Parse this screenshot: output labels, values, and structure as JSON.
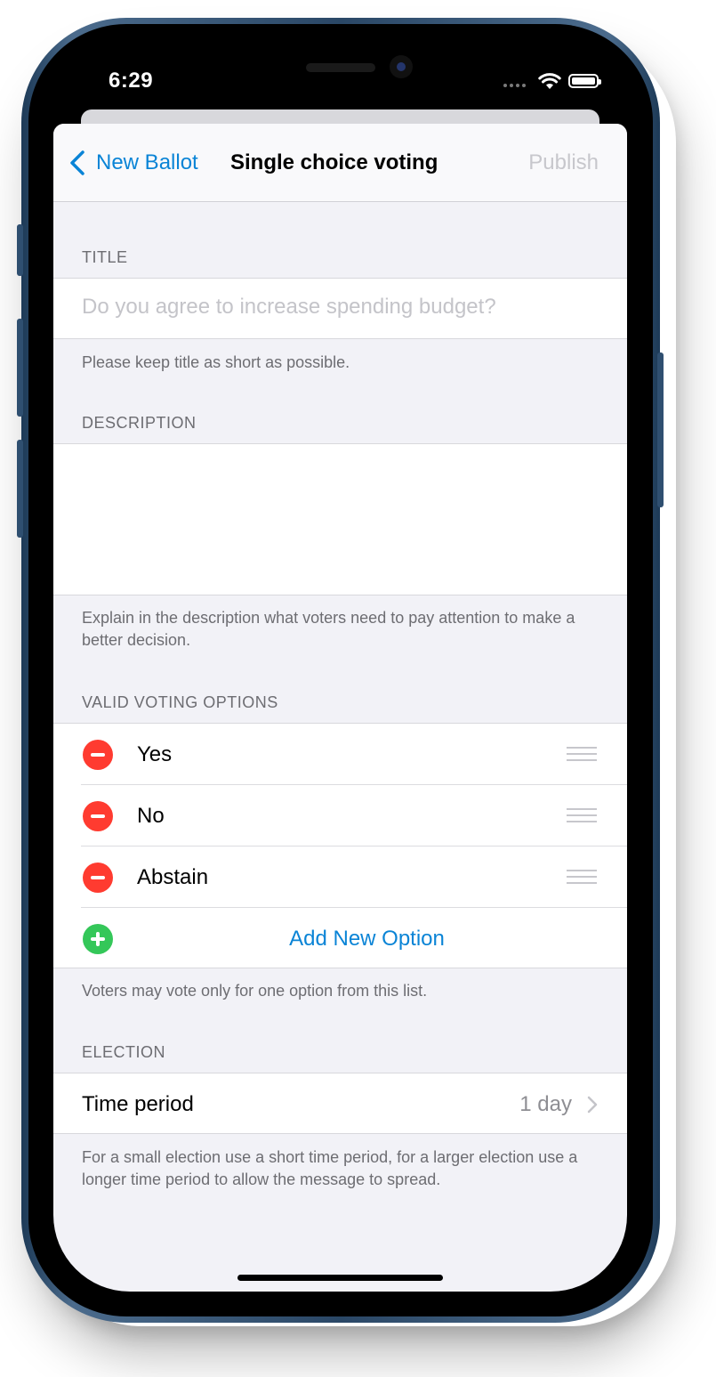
{
  "status_bar": {
    "time": "6:29"
  },
  "nav": {
    "back_label": "New Ballot",
    "title": "Single choice voting",
    "action_label": "Publish"
  },
  "title_section": {
    "header": "TITLE",
    "placeholder": "Do you agree to increase spending budget?",
    "value": "",
    "footer": "Please keep title as short as possible."
  },
  "description_section": {
    "header": "DESCRIPTION",
    "value": "",
    "footer": "Explain in the description what voters need to pay attention to make a better decision."
  },
  "options_section": {
    "header": "VALID VOTING OPTIONS",
    "options": [
      {
        "label": "Yes"
      },
      {
        "label": "No"
      },
      {
        "label": "Abstain"
      }
    ],
    "add_label": "Add New Option",
    "footer": "Voters may vote only for one option from this list."
  },
  "election_section": {
    "header": "ELECTION",
    "time_period_label": "Time period",
    "time_period_value": "1 day",
    "footer": "For a small election use a short time period, for a larger election use a longer time period to allow the message to spread."
  },
  "colors": {
    "accent": "#0a84d6",
    "destructive": "#ff3b30",
    "positive": "#34c759",
    "background": "#f2f2f7",
    "frame": "#2a4766"
  },
  "icons": [
    "chevron-left-icon",
    "minus-circle-icon",
    "plus-circle-icon",
    "drag-handle-icon",
    "chevron-right-icon",
    "wifi-icon",
    "battery-icon",
    "signal-dots-icon"
  ]
}
